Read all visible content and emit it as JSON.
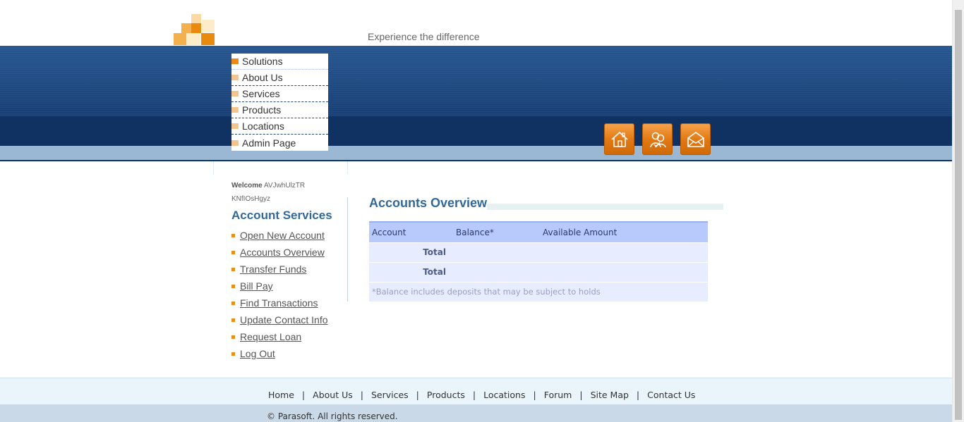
{
  "header": {
    "tagline": "Experience the difference"
  },
  "top_menu": {
    "items": [
      {
        "label": "Solutions"
      },
      {
        "label": "About Us"
      },
      {
        "label": "Services"
      },
      {
        "label": "Products"
      },
      {
        "label": "Locations"
      },
      {
        "label": "Admin Page"
      }
    ]
  },
  "header_buttons": [
    {
      "icon": "home-icon"
    },
    {
      "icon": "contact-icon"
    },
    {
      "icon": "email-icon"
    }
  ],
  "left_panel": {
    "welcome_label": "Welcome",
    "welcome_name_1": "AVJwhUlzTR",
    "welcome_name_2": "KNfIOsHgyz",
    "title": "Account Services",
    "links": [
      {
        "label": "Open New Account"
      },
      {
        "label": "Accounts Overview"
      },
      {
        "label": "Transfer Funds"
      },
      {
        "label": "Bill Pay"
      },
      {
        "label": "Find Transactions"
      },
      {
        "label": "Update Contact Info"
      },
      {
        "label": "Request Loan"
      },
      {
        "label": "Log Out"
      }
    ]
  },
  "main": {
    "title": "Accounts Overview",
    "table": {
      "headers": [
        "Account",
        "Balance*",
        "Available Amount"
      ],
      "rows": [
        {
          "total_label": "Total"
        },
        {
          "total_label": "Total"
        }
      ],
      "footnote": "*Balance includes deposits that may be subject to holds"
    }
  },
  "footer": {
    "links": [
      {
        "label": "Home"
      },
      {
        "label": "About Us"
      },
      {
        "label": "Services"
      },
      {
        "label": "Products"
      },
      {
        "label": "Locations"
      },
      {
        "label": "Forum"
      },
      {
        "label": "Site Map"
      },
      {
        "label": "Contact Us"
      }
    ],
    "separator": "|",
    "copyright": "© Parasoft. All rights reserved."
  },
  "colors": {
    "brand_blue": "#0f3263",
    "accent_orange": "#e27a14",
    "title_blue": "#33689a"
  }
}
